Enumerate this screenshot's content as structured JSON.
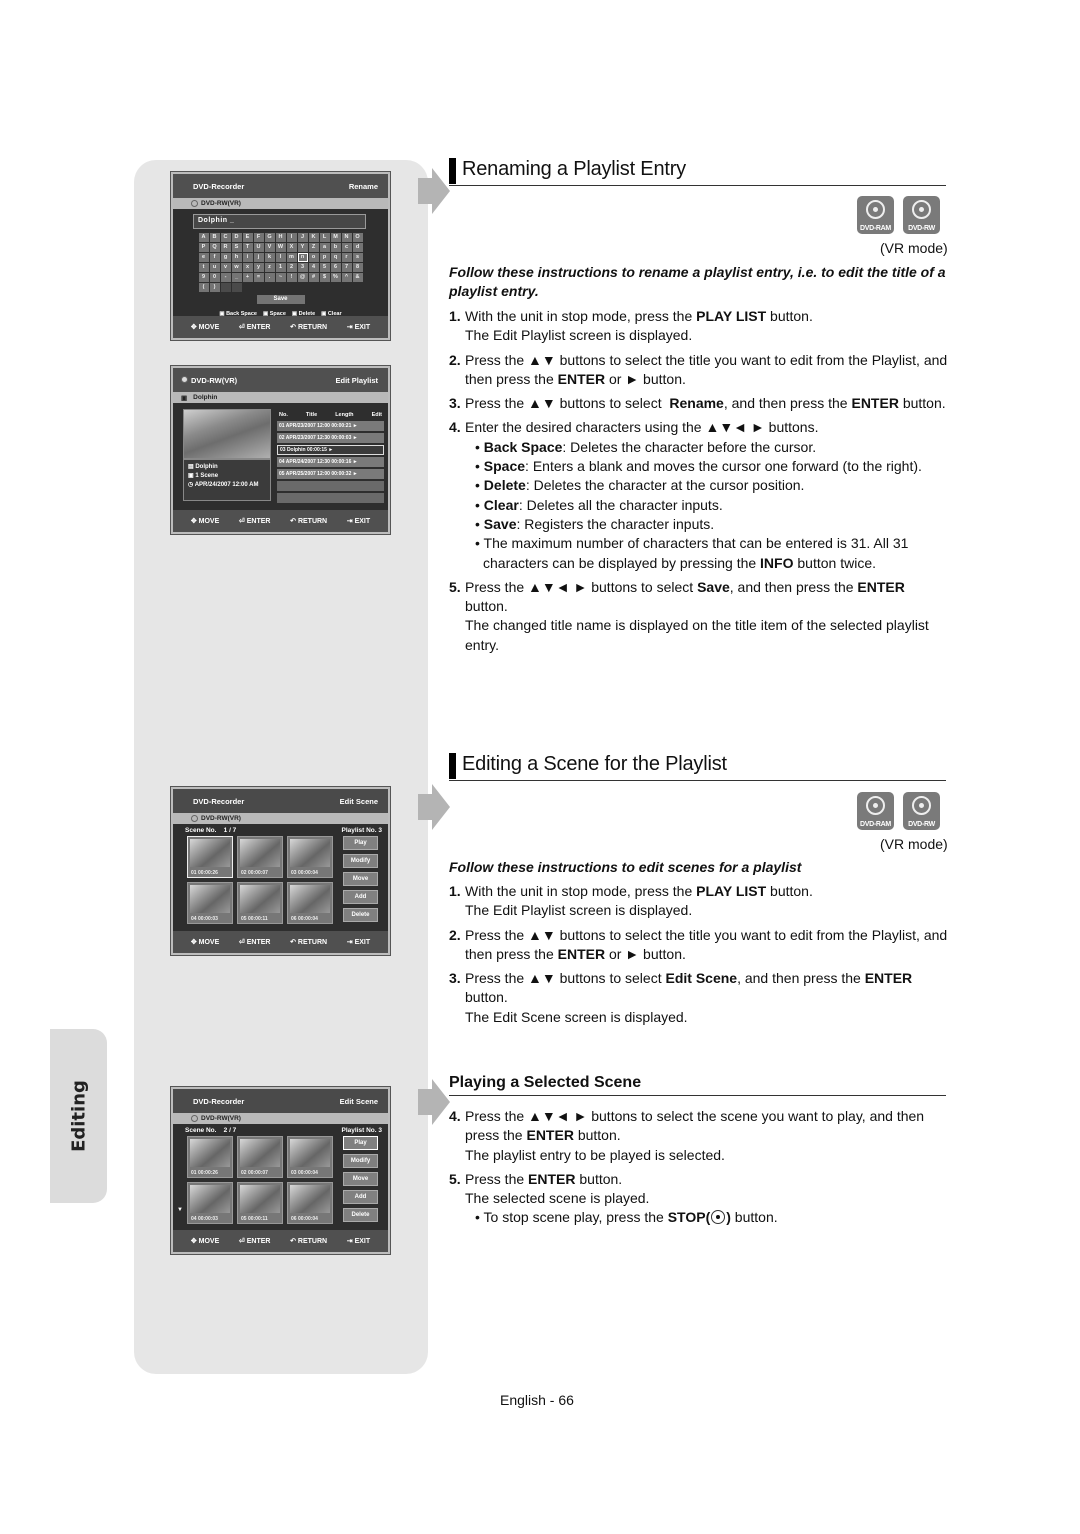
{
  "side_tab": "Editing",
  "page_number": "English - 66",
  "rename_screen": {
    "brand": "DVD-Recorder",
    "title": "Rename",
    "disc": "DVD-RW(VR)",
    "name_value": "Dolphin _",
    "keys": [
      "A",
      "B",
      "C",
      "D",
      "E",
      "F",
      "G",
      "H",
      "I",
      "J",
      "K",
      "L",
      "M",
      "N",
      "O",
      "P",
      "Q",
      "R",
      "S",
      "T",
      "U",
      "V",
      "W",
      "X",
      "Y",
      "Z",
      "a",
      "b",
      "c",
      "d",
      "e",
      "f",
      "g",
      "h",
      "i",
      "j",
      "k",
      "l",
      "m",
      "n",
      "o",
      "p",
      "q",
      "r",
      "s",
      "t",
      "u",
      "v",
      "w",
      "x",
      "y",
      "z",
      "1",
      "2",
      "3",
      "4",
      "5",
      "6",
      "7",
      "8",
      "9",
      "0",
      "-",
      "_",
      "+",
      "=",
      ".",
      "~",
      "!",
      "@",
      "#",
      "$",
      "%",
      "^",
      "&",
      "(",
      ")",
      "",
      ""
    ],
    "selected_key": "n",
    "save": "Save",
    "legend": [
      "Back Space",
      "Space",
      "Delete",
      "Clear"
    ]
  },
  "footer": {
    "move": "MOVE",
    "enter": "ENTER",
    "return": "RETURN",
    "exit": "EXIT"
  },
  "playlist_screen": {
    "disc": "DVD-RW(VR)",
    "title": "Edit Playlist",
    "current": "Dolphin",
    "info": [
      "Dolphin",
      "1 Scene",
      "APR/24/2007 12:00 AM"
    ],
    "columns": [
      "No.",
      "Title",
      "Length",
      "Edit"
    ],
    "rows": [
      "01 APR/23/2007  12:00  00:00:21",
      "02 APR/23/2007  12:30  00:00:03",
      "03 Dolphin                       00:00:15",
      "04 APR/24/2007  12:30  00:00:16",
      "05 APR/25/2007  12:00  00:00:32"
    ],
    "selected_row": 2
  },
  "scene_screens": [
    {
      "brand": "DVD-Recorder",
      "title": "Edit Scene",
      "disc": "DVD-RW(VR)",
      "scene_label": "Scene No.",
      "scene_no": "1 / 7",
      "playlist_label": "Playlist No.",
      "playlist_no": "3",
      "scenes": [
        "01  00:00:26",
        "02  00:00:07",
        "03  00:00:04",
        "04  00:00:03",
        "05  00:00:11",
        "06  00:00:04"
      ],
      "selected_scene": 0,
      "buttons": [
        "Play",
        "Modify",
        "Move",
        "Add",
        "Delete"
      ],
      "selected_button": -1
    },
    {
      "brand": "DVD-Recorder",
      "title": "Edit Scene",
      "disc": "DVD-RW(VR)",
      "scene_label": "Scene No.",
      "scene_no": "2 / 7",
      "playlist_label": "Playlist No.",
      "playlist_no": "3",
      "scenes": [
        "01  00:00:26",
        "02  00:00:07",
        "03  00:00:04",
        "04  00:00:03",
        "05  00:00:11",
        "06  00:00:04"
      ],
      "selected_scene": -1,
      "buttons": [
        "Play",
        "Modify",
        "Move",
        "Add",
        "Delete"
      ],
      "selected_button": 0
    }
  ],
  "badges": [
    "DVD-RAM",
    "DVD-RW"
  ],
  "vr_mode": "(VR mode)",
  "section1": {
    "title": "Renaming a Playlist Entry",
    "intro": "Follow these instructions to rename a playlist entry, i.e. to edit the title of a playlist entry.",
    "steps": [
      {
        "n": "1.",
        "html": "With the unit in stop mode, press the <b>PLAY LIST</b> button.<span class='l'>The Edit Playlist screen is displayed.</span>"
      },
      {
        "n": "2.",
        "html": "Press the ▲▼ buttons to select the title you want to edit from the Playlist, and then press the <b>ENTER</b> or ► button."
      },
      {
        "n": "3.",
        "html": "Press the ▲▼ buttons to select &nbsp;<b>Rename</b>, and then press the <b>ENTER</b> button."
      },
      {
        "n": "4.",
        "html": "Enter the desired characters using the ▲▼◄ ► buttons.<span class='bul'>• <b>Back Space</b>: Deletes the character before the cursor.</span><span class='bul'>• <b>Space</b>: Enters a blank and moves the cursor one forward (to the right).</span><span class='bul'>• <b>Delete</b>: Deletes the character at the cursor position.</span><span class='bul'>• <b>Clear</b>: Deletes all the character inputs.</span><span class='bul'>• <b>Save</b>: Registers the character inputs.</span><span class='note'>• The maximum number of characters that can be entered is 31. All 31 characters can be displayed by pressing the <b>INFO</b> button twice.</span>"
      },
      {
        "n": "5.",
        "html": "Press the ▲▼◄ ► buttons to select <b>Save</b>, and then press the <b>ENTER</b> button.<span class='l'>The changed title name is displayed on the title item of the selected playlist entry.</span>"
      }
    ]
  },
  "section2": {
    "title": "Editing a Scene for the Playlist",
    "intro": "Follow these instructions to edit scenes for a playlist",
    "steps": [
      {
        "n": "1.",
        "html": "With the unit in stop mode, press the <b>PLAY LIST</b> button.<span class='l'>The Edit Playlist screen is displayed.</span>"
      },
      {
        "n": "2.",
        "html": "Press the ▲▼ buttons to select the title you want to edit from the Playlist, and then press the <b>ENTER</b> or ► button."
      },
      {
        "n": "3.",
        "html": "Press the ▲▼ buttons to select <b>Edit Scene</b>, and then press the <b>ENTER</b> button.<span class='l'>The Edit Scene screen is displayed.</span>"
      }
    ]
  },
  "section3": {
    "title": "Playing a Selected Scene",
    "steps": [
      {
        "n": "4.",
        "html": "Press the ▲▼◄ ► buttons to select the scene you want to play, and then press the <b>ENTER</b> button.<span class='l'>The playlist entry to be played is selected.</span>"
      },
      {
        "n": "5.",
        "html": "Press the <b>ENTER</b> button.<span class='l'>The selected scene is played.</span><span class='note'>• To stop scene play, press the <b>STOP(<i class='stop-ic'></i>)</b> button.</span>"
      }
    ]
  }
}
